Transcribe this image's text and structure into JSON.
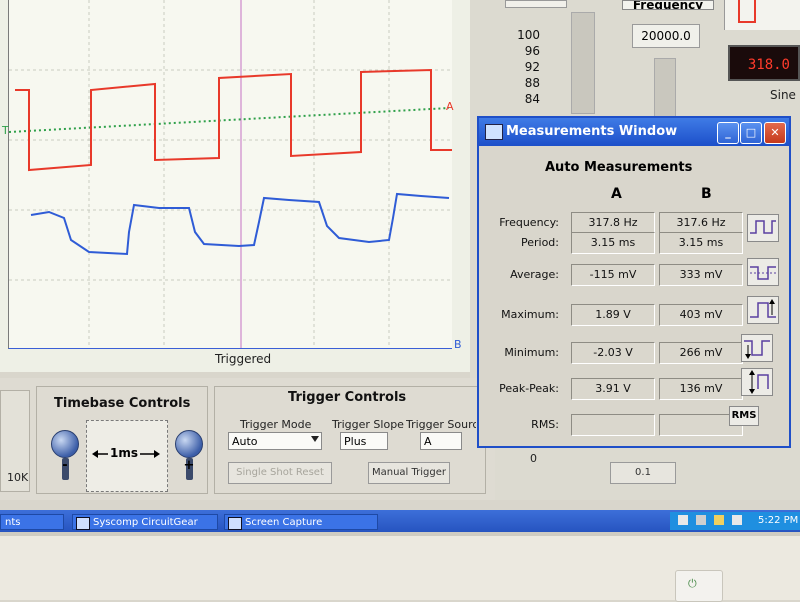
{
  "scope": {
    "triggered_label": "Triggered",
    "channel_a_marker": "A",
    "channel_b_marker": "B",
    "trigger_marker": "T",
    "colors": {
      "channel_a": "#e8392a",
      "channel_b": "#2f5cd6",
      "trigger_line": "#2fa04a",
      "cursor": "#c472c4"
    }
  },
  "right_panel": {
    "scale_values": [
      "100",
      "96",
      "92",
      "88",
      "84"
    ],
    "frequency_title": "Frequency",
    "frequency_value": "20000.0",
    "readout": "318.0",
    "waveform_select": "Sine",
    "bottom_values": [
      "0",
      "0.1"
    ]
  },
  "timebase": {
    "title": "Timebase Controls",
    "value": "1ms",
    "minus": "-",
    "plus": "+",
    "left_value": "10K"
  },
  "trigger": {
    "title": "Trigger Controls",
    "mode_label": "Trigger Mode",
    "mode_value": "Auto",
    "slope_label": "Trigger Slope",
    "slope_value": "Plus",
    "source_label": "Trigger Source",
    "source_value": "A",
    "single_shot": "Single Shot Reset",
    "manual": "Manual Trigger"
  },
  "measurements": {
    "window_title": "Measurements Window",
    "heading": "Auto Measurements",
    "col_a": "A",
    "col_b": "B",
    "rows": [
      {
        "label": "Frequency:",
        "a": "317.8 Hz",
        "b": "317.6 Hz",
        "icon": "period-wave-icon"
      },
      {
        "label": "Period:",
        "a": "3.15 ms",
        "b": "3.15 ms",
        "icon": ""
      },
      {
        "label": "Average:",
        "a": "-115 mV",
        "b": "333 mV",
        "icon": "average-wave-icon"
      },
      {
        "label": "Maximum:",
        "a": "1.89 V",
        "b": "403 mV",
        "icon": "maximum-wave-icon"
      },
      {
        "label": "Minimum:",
        "a": "-2.03 V",
        "b": "266 mV",
        "icon": "minimum-wave-icon"
      },
      {
        "label": "Peak-Peak:",
        "a": "3.91 V",
        "b": "136 mV",
        "icon": "peak-peak-icon"
      },
      {
        "label": "RMS:",
        "a": "",
        "b": "",
        "icon": "rms-icon"
      }
    ],
    "rms_badge": "RMS"
  },
  "taskbar": {
    "items": [
      "nts Window",
      "Syscomp CircuitGear",
      "Screen Capture"
    ],
    "clock": "5:22 PM"
  }
}
